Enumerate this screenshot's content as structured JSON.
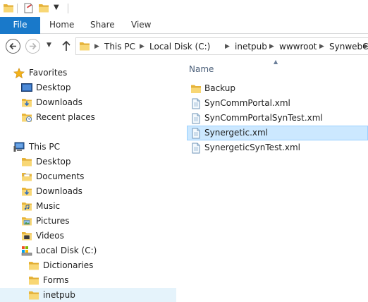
{
  "quick_access": {
    "icons": [
      "folder-icon",
      "properties-icon",
      "new-folder-icon",
      "customize-dropdown-icon"
    ]
  },
  "ribbon": {
    "file": "File",
    "tabs": [
      "Home",
      "Share",
      "View"
    ]
  },
  "address": {
    "crumbs": [
      "This PC",
      "Local Disk (C:)",
      "inetpub",
      "wwwroot",
      "SynwebCfg"
    ]
  },
  "navpane": {
    "favorites": {
      "label": "Favorites",
      "items": [
        "Desktop",
        "Downloads",
        "Recent places"
      ]
    },
    "this_pc": {
      "label": "This PC",
      "items": [
        "Desktop",
        "Documents",
        "Downloads",
        "Music",
        "Pictures",
        "Videos",
        "Local Disk (C:)"
      ]
    },
    "local_disk_children": [
      "Dictionaries",
      "Forms",
      "inetpub"
    ],
    "selected": "inetpub"
  },
  "filelist": {
    "column_name": "Name",
    "rows": [
      {
        "name": "Backup",
        "type": "folder"
      },
      {
        "name": "SynCommPortal.xml",
        "type": "xml"
      },
      {
        "name": "SynCommPortalSynTest.xml",
        "type": "xml"
      },
      {
        "name": "Synergetic.xml",
        "type": "xml",
        "selected": true
      },
      {
        "name": "SynergeticSynTest.xml",
        "type": "xml"
      }
    ]
  },
  "colors": {
    "file_tab": "#1979ca",
    "selection_fill": "#cce8ff",
    "selection_border": "#99d1ff",
    "nav_selected": "#e5f3fb",
    "folder_yellow": "#f5c94c"
  }
}
